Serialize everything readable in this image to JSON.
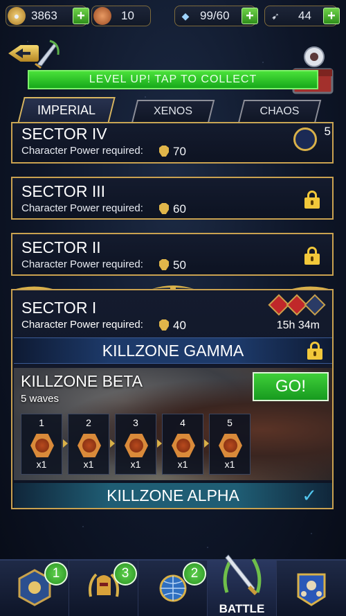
{
  "resources": {
    "gold": "3863",
    "tokens": "10",
    "energy": "99/60",
    "blades": "44"
  },
  "header": {
    "level_up": "LEVEL UP! TAP TO COLLECT"
  },
  "tabs": [
    "IMPERIAL",
    "XENOS",
    "CHAOS"
  ],
  "sectors": [
    {
      "name": "SECTOR IV",
      "req_label": "Character Power required:",
      "power": "70",
      "team_count": "5"
    },
    {
      "name": "SECTOR III",
      "req_label": "Character Power required:",
      "power": "60"
    },
    {
      "name": "SECTOR II",
      "req_label": "Character Power required:",
      "power": "50"
    },
    {
      "name": "SECTOR I",
      "req_label": "Character Power required:",
      "power": "40",
      "timer": "15h 34m"
    }
  ],
  "killzones": {
    "gamma": "KILLZONE GAMMA",
    "beta": "KILLZONE BETA",
    "beta_waves": "5 waves",
    "go": "GO!",
    "alpha": "KILLZONE ALPHA",
    "check": "✓"
  },
  "waves": [
    {
      "num": "1",
      "qty": "x1"
    },
    {
      "num": "2",
      "qty": "x1"
    },
    {
      "num": "3",
      "qty": "x1"
    },
    {
      "num": "4",
      "qty": "x1"
    },
    {
      "num": "5",
      "qty": "x1"
    }
  ],
  "nav": {
    "badge1": "1",
    "badge2": "3",
    "badge3": "2",
    "battle": "BATTLE"
  },
  "colors": {
    "gold_border": "#caa250",
    "go_green": "#2fbf2d",
    "level_green": "#2bc527",
    "lock_yellow": "#f2c83a"
  }
}
